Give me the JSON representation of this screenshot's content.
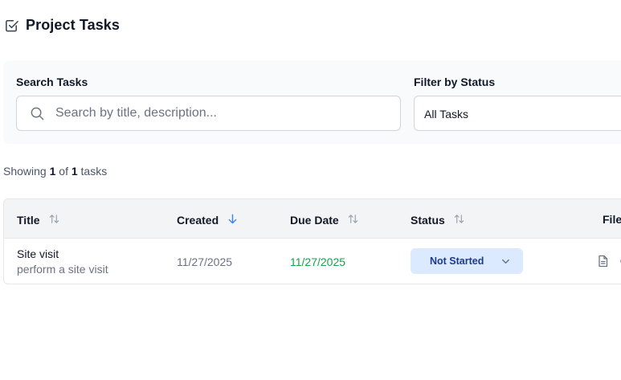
{
  "header": {
    "title": "Project Tasks",
    "icon": "checkbox-icon"
  },
  "filters": {
    "search_label": "Search Tasks",
    "search_placeholder": "Search by title, description...",
    "search_value": "",
    "status_label": "Filter by Status",
    "status_selected": "All Tasks"
  },
  "summary": {
    "prefix": "Showing",
    "shown": "1",
    "of": "of",
    "total": "1",
    "suffix": "tasks"
  },
  "table": {
    "columns": [
      {
        "label": "Title",
        "sort": "none"
      },
      {
        "label": "Created",
        "sort": "desc"
      },
      {
        "label": "Due Date",
        "sort": "none"
      },
      {
        "label": "Status",
        "sort": "none"
      },
      {
        "label": "File"
      }
    ],
    "rows": [
      {
        "title": "Site visit",
        "description": "perform a site visit",
        "created": "11/27/2025",
        "due": "11/27/2025",
        "status": "Not Started"
      }
    ]
  },
  "colors": {
    "accent": "#3b82f6",
    "due_date": "#16a34a",
    "status_bg": "#dbeafe",
    "status_text": "#1e3a8a"
  }
}
